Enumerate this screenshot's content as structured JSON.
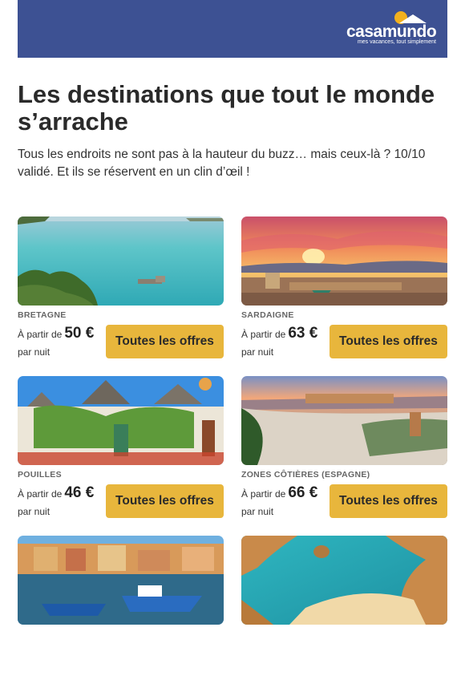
{
  "header": {
    "logo_text": "casamundo",
    "logo_tagline": "mes vacances, tout simplement",
    "background_color": "#3d5193",
    "sun_color": "#f2b01e"
  },
  "title": "Les destinations que tout le monde s’arrache",
  "intro": "Tous les endroits ne sont pas à la hauteur du buzz… mais ceux-là ? 10/10 validé. Et ils se réservent en un clin d’œil !",
  "button_color": "#e8b63c",
  "destinations": [
    {
      "name": "BRETAGNE",
      "from_label": "À partir de",
      "price": "50 €",
      "per_night": "par nuit",
      "button": "Toutes les offres",
      "image": "coastal-cove-photo"
    },
    {
      "name": "SARDAIGNE",
      "from_label": "À partir de",
      "price": "63 €",
      "per_night": "par nuit",
      "button": "Toutes les offres",
      "image": "sunset-city-photo"
    },
    {
      "name": "POUILLES",
      "from_label": "À partir de",
      "price": "46 €",
      "per_night": "par nuit",
      "button": "Toutes les offres",
      "image": "trulli-houses-photo"
    },
    {
      "name": "ZONES CÔTIÈRES (ESPAGNE)",
      "from_label": "À partir de",
      "price": "66 €",
      "per_night": "par nuit",
      "button": "Toutes les offres",
      "image": "granada-alhambra-photo"
    },
    {
      "name": "",
      "image": "harbor-boats-photo"
    },
    {
      "name": "",
      "image": "algarve-beach-photo"
    }
  ]
}
